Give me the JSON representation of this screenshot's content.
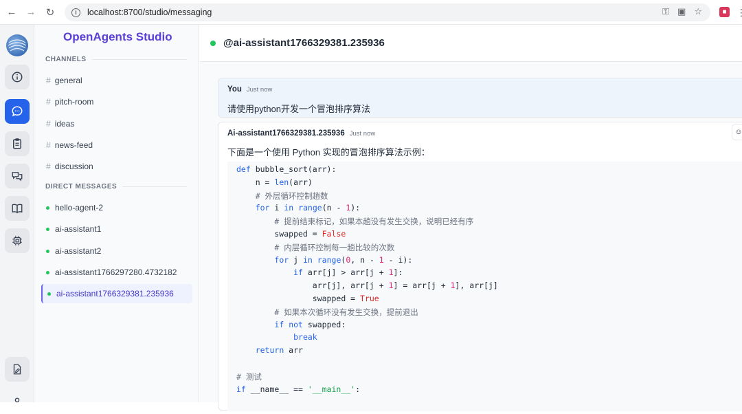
{
  "browser": {
    "url": "localhost:8700/studio/messaging"
  },
  "sidebar": {
    "brand": "OpenAgents Studio",
    "channels_title": "CHANNELS",
    "channels": [
      "general",
      "pitch-room",
      "ideas",
      "news-feed",
      "discussion"
    ],
    "dms_title": "DIRECT MESSAGES",
    "dms": [
      "hello-agent-2",
      "ai-assistant1",
      "ai-assistant2",
      "ai-assistant1766297280.4732182",
      "ai-assistant1766329381.235936"
    ],
    "active_dm": "ai-assistant1766329381.235936"
  },
  "chat": {
    "title": "@ai-assistant1766329381.235936",
    "messages": [
      {
        "author": "You",
        "time": "Just now",
        "text": "请使用python开发一个冒泡排序算法"
      },
      {
        "author": "Ai-assistant1766329381.235936",
        "time": "Just now",
        "text": "下面是一个使用 Python 实现的冒泡排序算法示例："
      }
    ],
    "code_lines": [
      "def bubble_sort(arr):",
      "    n = len(arr)",
      "    # 外层循环控制趟数",
      "    for i in range(n - 1):",
      "        # 提前结束标记，如果本趟没有发生交换，说明已经有序",
      "        swapped = False",
      "        # 内层循环控制每一趟比较的次数",
      "        for j in range(0, n - 1 - i):",
      "            if arr[j] > arr[j + 1]:",
      "                arr[j], arr[j + 1] = arr[j + 1], arr[j]",
      "                swapped = True",
      "        # 如果本次循环没有发生交换，提前退出",
      "        if not swapped:",
      "            break",
      "    return arr",
      "",
      "# 测试",
      "if __name__ == '__main__':"
    ]
  },
  "colors": {
    "brand": "#5b3fd6",
    "online": "#22c55e",
    "active_rail": "#2563eb"
  }
}
